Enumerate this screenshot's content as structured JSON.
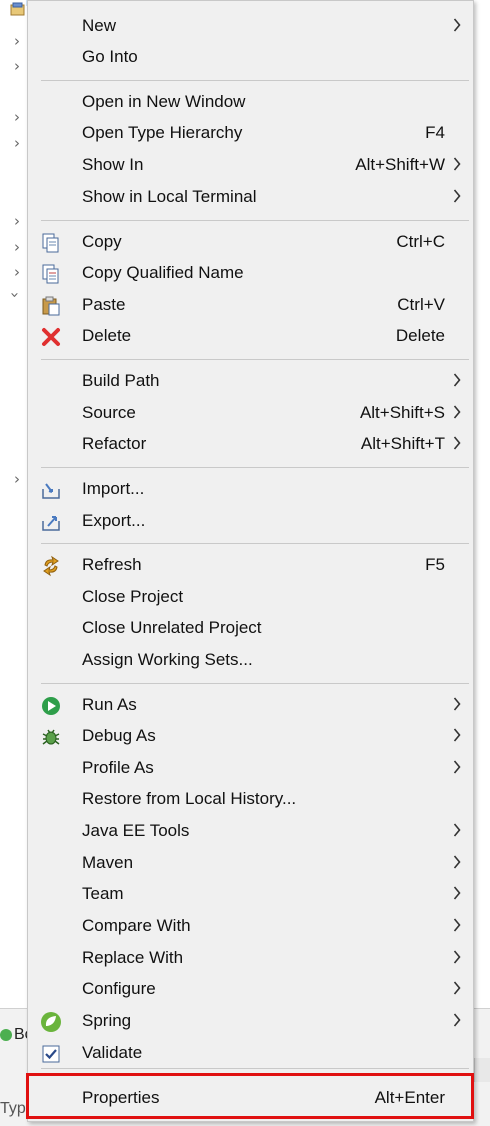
{
  "menu": {
    "items": [
      {
        "label": "New",
        "shortcut": "",
        "submenu": true,
        "icon": ""
      },
      {
        "label": "Go Into",
        "shortcut": "",
        "submenu": false,
        "icon": ""
      },
      {
        "label": "Open in New Window",
        "shortcut": "",
        "submenu": false,
        "icon": ""
      },
      {
        "label": "Open Type Hierarchy",
        "shortcut": "F4",
        "submenu": false,
        "icon": ""
      },
      {
        "label": "Show In",
        "shortcut": "Alt+Shift+W",
        "submenu": true,
        "icon": ""
      },
      {
        "label": "Show in Local Terminal",
        "shortcut": "",
        "submenu": true,
        "icon": ""
      },
      {
        "label": "Copy",
        "shortcut": "Ctrl+C",
        "submenu": false,
        "icon": "copy-icon"
      },
      {
        "label": "Copy Qualified Name",
        "shortcut": "",
        "submenu": false,
        "icon": "copy-qualified-name-icon"
      },
      {
        "label": "Paste",
        "shortcut": "Ctrl+V",
        "submenu": false,
        "icon": "paste-icon"
      },
      {
        "label": "Delete",
        "shortcut": "Delete",
        "submenu": false,
        "icon": "delete-icon"
      },
      {
        "label": "Build Path",
        "shortcut": "",
        "submenu": true,
        "icon": ""
      },
      {
        "label": "Source",
        "shortcut": "Alt+Shift+S",
        "submenu": true,
        "icon": ""
      },
      {
        "label": "Refactor",
        "shortcut": "Alt+Shift+T",
        "submenu": true,
        "icon": ""
      },
      {
        "label": "Import...",
        "shortcut": "",
        "submenu": false,
        "icon": "import-icon"
      },
      {
        "label": "Export...",
        "shortcut": "",
        "submenu": false,
        "icon": "export-icon"
      },
      {
        "label": "Refresh",
        "shortcut": "F5",
        "submenu": false,
        "icon": "refresh-icon"
      },
      {
        "label": "Close Project",
        "shortcut": "",
        "submenu": false,
        "icon": ""
      },
      {
        "label": "Close Unrelated Project",
        "shortcut": "",
        "submenu": false,
        "icon": ""
      },
      {
        "label": "Assign Working Sets...",
        "shortcut": "",
        "submenu": false,
        "icon": ""
      },
      {
        "label": "Run As",
        "shortcut": "",
        "submenu": true,
        "icon": "run-icon"
      },
      {
        "label": "Debug As",
        "shortcut": "",
        "submenu": true,
        "icon": "debug-icon"
      },
      {
        "label": "Profile As",
        "shortcut": "",
        "submenu": true,
        "icon": ""
      },
      {
        "label": "Restore from Local History...",
        "shortcut": "",
        "submenu": false,
        "icon": ""
      },
      {
        "label": "Java EE Tools",
        "shortcut": "",
        "submenu": true,
        "icon": ""
      },
      {
        "label": "Maven",
        "shortcut": "",
        "submenu": true,
        "icon": ""
      },
      {
        "label": "Team",
        "shortcut": "",
        "submenu": true,
        "icon": ""
      },
      {
        "label": "Compare With",
        "shortcut": "",
        "submenu": true,
        "icon": ""
      },
      {
        "label": "Replace With",
        "shortcut": "",
        "submenu": true,
        "icon": ""
      },
      {
        "label": "Configure",
        "shortcut": "",
        "submenu": true,
        "icon": ""
      },
      {
        "label": "Spring",
        "shortcut": "",
        "submenu": true,
        "icon": "spring-icon"
      },
      {
        "label": "Validate",
        "shortcut": "",
        "submenu": false,
        "icon": "validate-checkbox-icon"
      },
      {
        "label": "Properties",
        "shortcut": "Alt+Enter",
        "submenu": false,
        "icon": ""
      }
    ]
  },
  "background": {
    "bottom_tab_label": "Bo",
    "bottom_input_text": "Typ"
  },
  "colors": {
    "menu_bg": "#f0f0f0",
    "highlight_border": "#e01010"
  }
}
